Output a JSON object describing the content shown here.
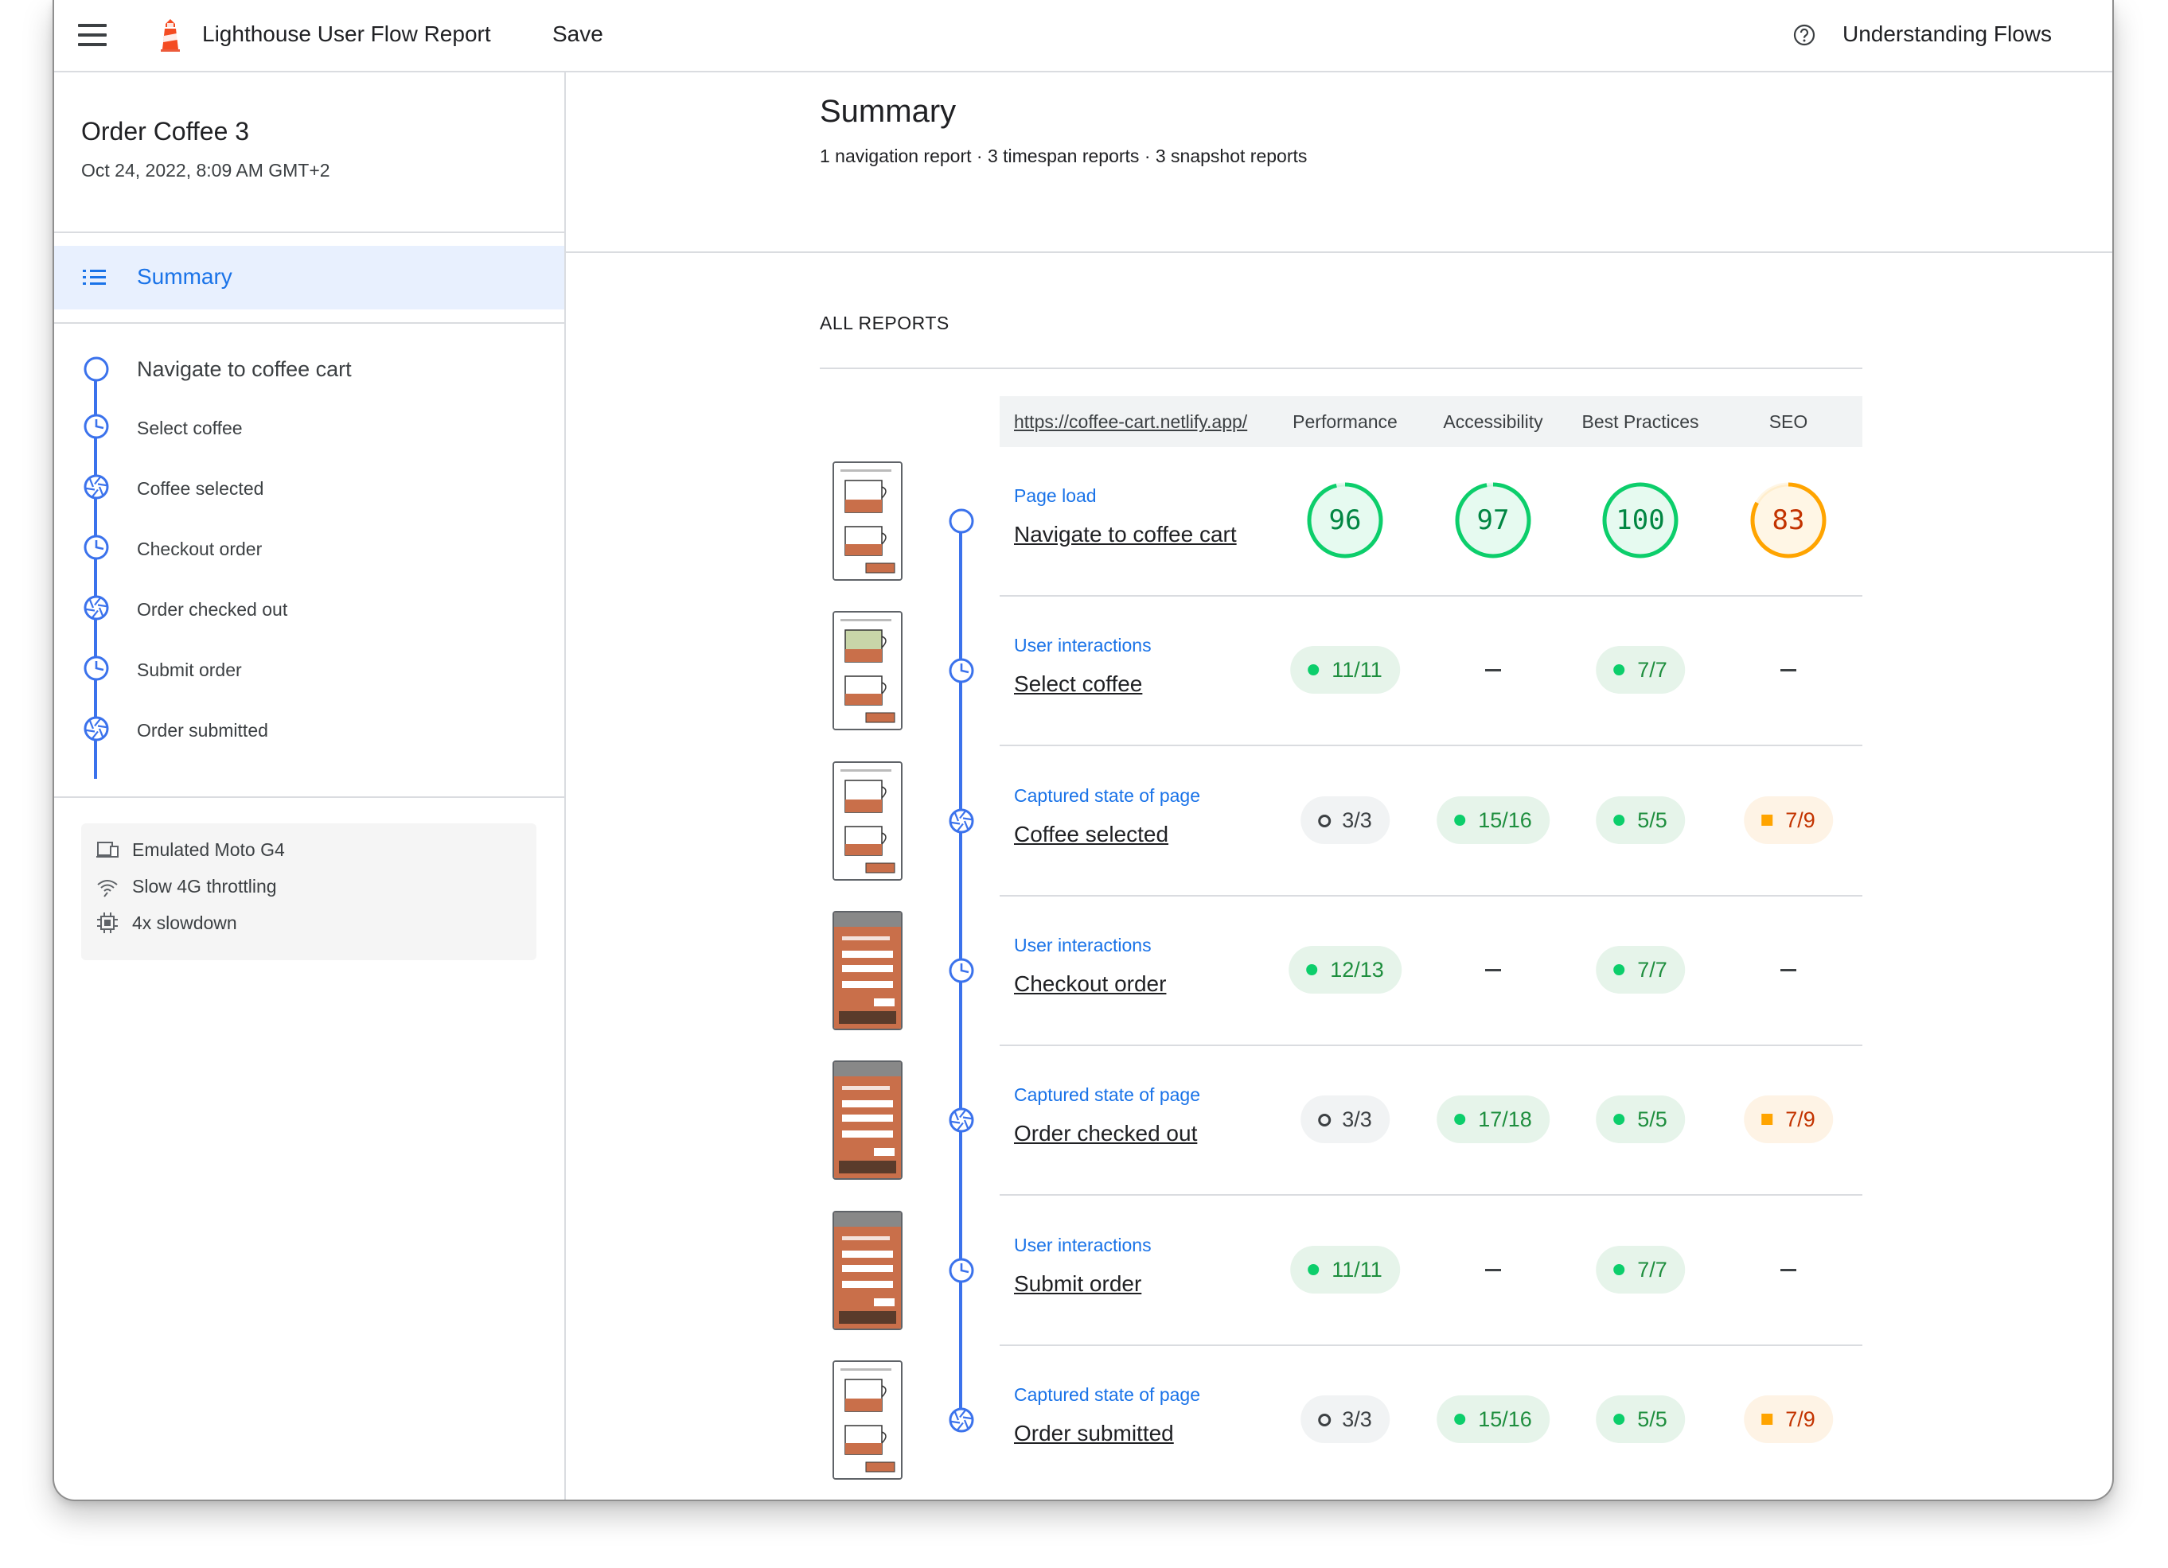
{
  "topbar": {
    "title": "Lighthouse User Flow Report",
    "save_label": "Save",
    "help_label": "Understanding Flows"
  },
  "sidebar": {
    "flow_name": "Order Coffee 3",
    "date": "Oct 24, 2022, 8:09 AM GMT+2",
    "summary_label": "Summary",
    "steps": [
      {
        "label": "Navigate to coffee cart",
        "icon": "navigation-icon"
      },
      {
        "label": "Select coffee",
        "icon": "timespan-icon"
      },
      {
        "label": "Coffee selected",
        "icon": "snapshot-icon"
      },
      {
        "label": "Checkout order",
        "icon": "timespan-icon"
      },
      {
        "label": "Order checked out",
        "icon": "snapshot-icon"
      },
      {
        "label": "Submit order",
        "icon": "timespan-icon"
      },
      {
        "label": "Order submitted",
        "icon": "snapshot-icon"
      }
    ],
    "environment": [
      {
        "label": "Emulated Moto G4",
        "icon": "device-icon"
      },
      {
        "label": "Slow 4G throttling",
        "icon": "network-icon"
      },
      {
        "label": "4x slowdown",
        "icon": "cpu-icon"
      }
    ]
  },
  "main": {
    "title": "Summary",
    "subtitle": "1 navigation report · 3 timespan reports · 3 snapshot reports",
    "section_label": "ALL REPORTS",
    "url": "https://coffee-cart.netlify.app/",
    "columns": [
      "Performance",
      "Accessibility",
      "Best Practices",
      "SEO"
    ],
    "rows": [
      {
        "type": "Page load",
        "name": "Navigate to coffee cart",
        "kind": "navigation",
        "scores": [
          {
            "gauge": "96"
          },
          {
            "gauge": "97"
          },
          {
            "gauge": "100"
          },
          {
            "gauge": "83"
          }
        ]
      },
      {
        "type": "User interactions",
        "name": "Select coffee",
        "kind": "timespan",
        "scores": [
          {
            "pill": "11/11",
            "status": "pass"
          },
          {
            "dash": true
          },
          {
            "pill": "7/7",
            "status": "pass"
          },
          {
            "dash": true
          }
        ]
      },
      {
        "type": "Captured state of page",
        "name": "Coffee selected",
        "kind": "snapshot",
        "scores": [
          {
            "pill": "3/3",
            "status": "info"
          },
          {
            "pill": "15/16",
            "status": "pass"
          },
          {
            "pill": "5/5",
            "status": "pass"
          },
          {
            "pill": "7/9",
            "status": "warn"
          }
        ]
      },
      {
        "type": "User interactions",
        "name": "Checkout order",
        "kind": "timespan",
        "scores": [
          {
            "pill": "12/13",
            "status": "pass"
          },
          {
            "dash": true
          },
          {
            "pill": "7/7",
            "status": "pass"
          },
          {
            "dash": true
          }
        ]
      },
      {
        "type": "Captured state of page",
        "name": "Order checked out",
        "kind": "snapshot",
        "scores": [
          {
            "pill": "3/3",
            "status": "info"
          },
          {
            "pill": "17/18",
            "status": "pass"
          },
          {
            "pill": "5/5",
            "status": "pass"
          },
          {
            "pill": "7/9",
            "status": "warn"
          }
        ]
      },
      {
        "type": "User interactions",
        "name": "Submit order",
        "kind": "timespan",
        "scores": [
          {
            "pill": "11/11",
            "status": "pass"
          },
          {
            "dash": true
          },
          {
            "pill": "7/7",
            "status": "pass"
          },
          {
            "dash": true
          }
        ]
      },
      {
        "type": "Captured state of page",
        "name": "Order submitted",
        "kind": "snapshot",
        "scores": [
          {
            "pill": "3/3",
            "status": "info"
          },
          {
            "pill": "15/16",
            "status": "pass"
          },
          {
            "pill": "5/5",
            "status": "pass"
          },
          {
            "pill": "7/9",
            "status": "warn"
          }
        ]
      }
    ]
  },
  "colors": {
    "accent": "#1a73e8",
    "timeline": "#3b72ec",
    "pass": "#0cce6b",
    "pass_text": "#018642",
    "average": "#ffa400",
    "average_text": "#c33300",
    "selected_bg": "#e8f0fe"
  }
}
